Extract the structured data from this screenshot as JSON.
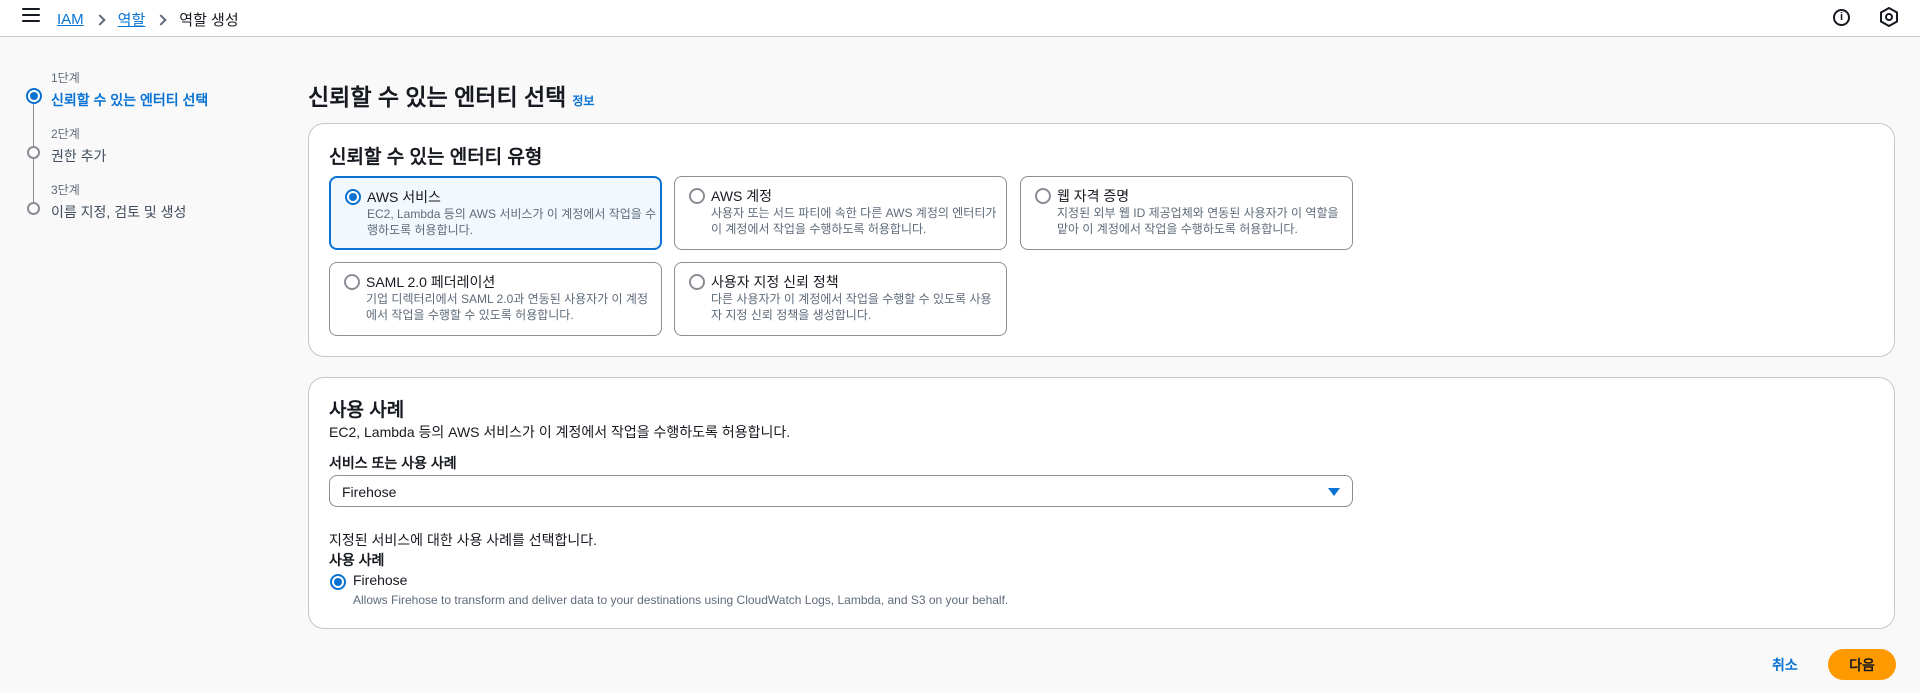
{
  "breadcrumb": {
    "items": [
      "IAM",
      "역할"
    ],
    "current": "역할 생성"
  },
  "steps": [
    {
      "num": "1단계",
      "label": "신뢰할 수 있는 엔터티 선택"
    },
    {
      "num": "2단계",
      "label": "권한 추가"
    },
    {
      "num": "3단계",
      "label": "이름 지정, 검토 및 생성"
    }
  ],
  "page": {
    "title": "신뢰할 수 있는 엔터티 선택",
    "info": "정보"
  },
  "entity_type": {
    "title": "신뢰할 수 있는 엔터티 유형",
    "options": [
      {
        "title": "AWS 서비스",
        "desc": "EC2, Lambda 등의 AWS 서비스가 이 계정에서 작업을 수행하도록 허용합니다."
      },
      {
        "title": "AWS 계정",
        "desc": "사용자 또는 서드 파티에 속한 다른 AWS 계정의 엔터티가 이 계정에서 작업을 수행하도록 허용합니다."
      },
      {
        "title": "웹 자격 증명",
        "desc": "지정된 외부 웹 ID 제공업체와 연동된 사용자가 이 역할을 맡아 이 계정에서 작업을 수행하도록 허용합니다."
      },
      {
        "title": "SAML 2.0 페더레이션",
        "desc": "기업 디렉터리에서 SAML 2.0과 연동된 사용자가 이 계정에서 작업을 수행할 수 있도록 허용합니다."
      },
      {
        "title": "사용자 지정 신뢰 정책",
        "desc": "다른 사용자가 이 계정에서 작업을 수행할 수 있도록 사용자 지정 신뢰 정책을 생성합니다."
      }
    ]
  },
  "use_case": {
    "title": "사용 사례",
    "desc": "EC2, Lambda 등의 AWS 서비스가 이 계정에서 작업을 수행하도록 허용합니다.",
    "select_label": "서비스 또는 사용 사례",
    "select_value": "Firehose",
    "hint": "지정된 서비스에 대한 사용 사례를 선택합니다.",
    "radio_group_label": "사용 사례",
    "option_label": "Firehose",
    "option_desc": "Allows Firehose to transform and deliver data to your destinations using CloudWatch Logs, Lambda, and S3 on your behalf."
  },
  "footer": {
    "cancel": "취소",
    "next": "다음"
  },
  "icons": [
    "menu-icon",
    "chevron-right-icon",
    "info-icon",
    "hexagon-settings-icon",
    "caret-down-icon"
  ],
  "colors": {
    "accent": "#0972d3",
    "primary_button": "#ff9900"
  }
}
